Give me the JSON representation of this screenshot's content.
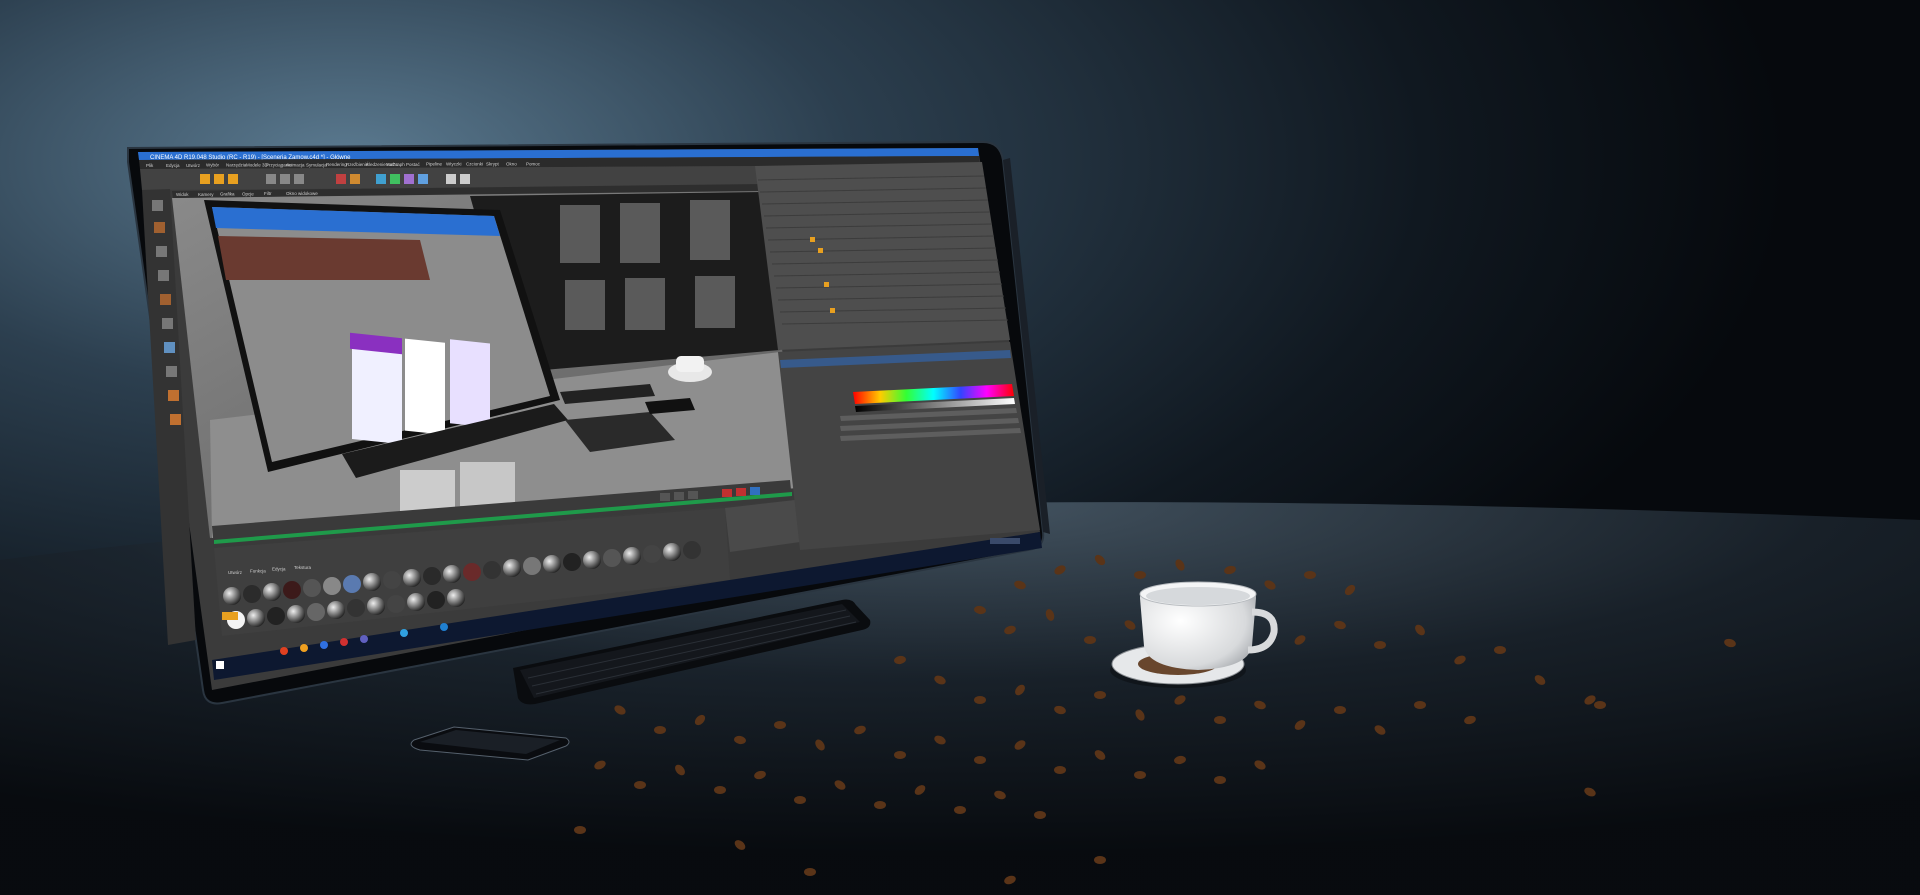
{
  "app": {
    "title": "CINEMA 4D R19.048 Studio (RC - R19) - [Sceneria Zamow.c4d *] - Główne",
    "menu": [
      "Plik",
      "Edycja",
      "Utwórz",
      "Wybór",
      "Narzędzia",
      "Modele 3D",
      "Przyciąganie",
      "Animacja",
      "Symulacja",
      "Rendering",
      "Rzeźbienie",
      "Śledzenie ruchu",
      "MoGraph",
      "Postać",
      "Pipeline",
      "Wtyczki",
      "Czcionki",
      "Skrypt",
      "Okno",
      "Pomoc"
    ],
    "viewport_menu": [
      "Widok",
      "Kamery",
      "Grafika",
      "Opcje",
      "Filtr",
      "Okno widokowe"
    ],
    "material_menu": [
      "Utwórz",
      "Funkcja",
      "Edycja",
      "Tekstura"
    ],
    "colors": {
      "accent": "#2a6fd1",
      "panel": "#4a4a4a",
      "viewport": "#6e6e6e",
      "coffee_bean": "#5a3418"
    }
  }
}
